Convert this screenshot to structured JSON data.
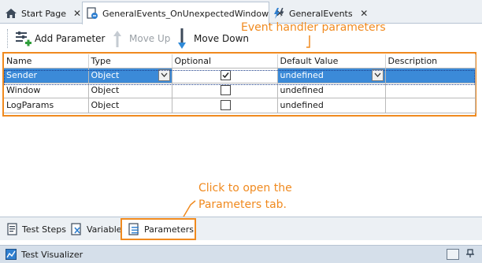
{
  "tabs": [
    {
      "label": "Start Page",
      "icon": "home-icon",
      "close": "✕"
    },
    {
      "label": "GeneralEvents_OnUnexpectedWindow",
      "icon": "event-handler-icon",
      "close": "✕"
    },
    {
      "label": "GeneralEvents",
      "icon": "events-icon",
      "close": "✕"
    }
  ],
  "toolbar": {
    "add_label": "Add Parameter",
    "up_label": "Move Up",
    "down_label": "Move Down"
  },
  "annotations": {
    "top": "Event handler parameters",
    "bottom_line1": "Click to open the",
    "bottom_line2": "Parameters tab."
  },
  "grid": {
    "columns": [
      "Name",
      "Type",
      "Optional",
      "Default Value",
      "Description"
    ],
    "rows": [
      {
        "name": "Sender",
        "type": "Object",
        "optional": true,
        "default": "undefined",
        "description": "",
        "selected": true
      },
      {
        "name": "Window",
        "type": "Object",
        "optional": false,
        "default": "undefined",
        "description": "",
        "selected": false
      },
      {
        "name": "LogParams",
        "type": "Object",
        "optional": false,
        "default": "undefined",
        "description": "",
        "selected": false
      }
    ],
    "check_glyph": "✓",
    "dropdown_glyph": "⌄"
  },
  "bottom_tabs": [
    {
      "label": "Test Steps",
      "icon": "test-steps-icon"
    },
    {
      "label": "Variables",
      "icon": "variables-icon"
    },
    {
      "label": "Parameters",
      "icon": "parameters-icon"
    }
  ],
  "status": {
    "label": "Test Visualizer"
  },
  "colors": {
    "accent": "#f08a1f",
    "selection": "#3b8ad8",
    "chrome": "#ecf0f4"
  }
}
